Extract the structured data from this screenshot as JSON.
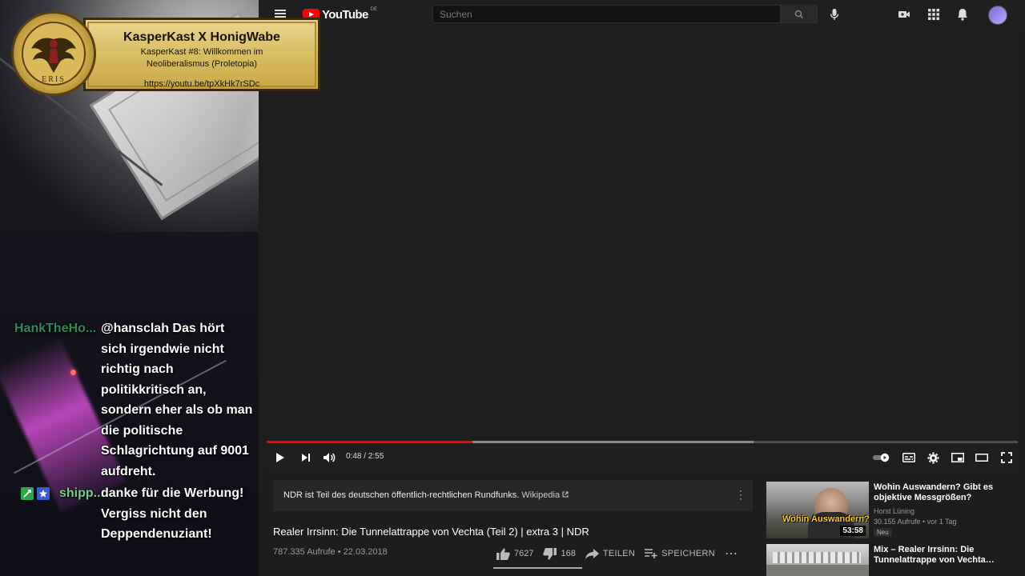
{
  "stream_overlay": {
    "banner": {
      "title": "KasperKast X HonigWabe",
      "subtitle": "KasperKast #8: Willkommen im Neoliberalismus (Proletopia)",
      "link": "https://youtu.be/tpXkHk7rSDc",
      "logo_text": "ERIS"
    },
    "chat": [
      {
        "user": "HankTheHo...",
        "user_color": "#2e8b57",
        "message": "@hansclah Das hört sich irgendwie nicht richtig nach politikkritisch an, sondern eher als ob man die politische Schlagrichtung auf 9001 aufdreht."
      },
      {
        "user": "shipp...",
        "user_color": "#6fd18a",
        "message": "danke für die Werbung! Vergiss nicht den Deppendenuziant!"
      }
    ]
  },
  "youtube": {
    "logo": "YouTube",
    "country": "DE",
    "search": {
      "placeholder": "Suchen"
    },
    "player": {
      "time": "0:48 / 2:55",
      "played_fraction": 0.274,
      "loaded_fraction": 0.648
    },
    "info_panel": {
      "text": "NDR ist Teil des deutschen öffentlich-rechtlichen Rundfunks.",
      "link": "Wikipedia"
    },
    "video": {
      "title": "Realer Irrsinn: Die Tunnelattrappe von Vechta (Teil 2) | extra 3 | NDR",
      "views": "787.335 Aufrufe",
      "date": "22.03.2018",
      "likes": "7627",
      "dislikes": "168",
      "share": "TEILEN",
      "save": "SPEICHERN"
    },
    "recommendations": [
      {
        "title": "Wohin Auswandern? Gibt es objektive Messgrößen?",
        "channel": "Horst Lüning",
        "meta": "30.155 Aufrufe • vor 1 Tag",
        "badge": "Neu",
        "duration": "53:58",
        "thumb_text": "Wohin Auswandern? Kenzahlen, Fak"
      },
      {
        "title": "Mix – Realer Irrsinn: Die Tunnelattrappe von Vechta…"
      }
    ]
  }
}
